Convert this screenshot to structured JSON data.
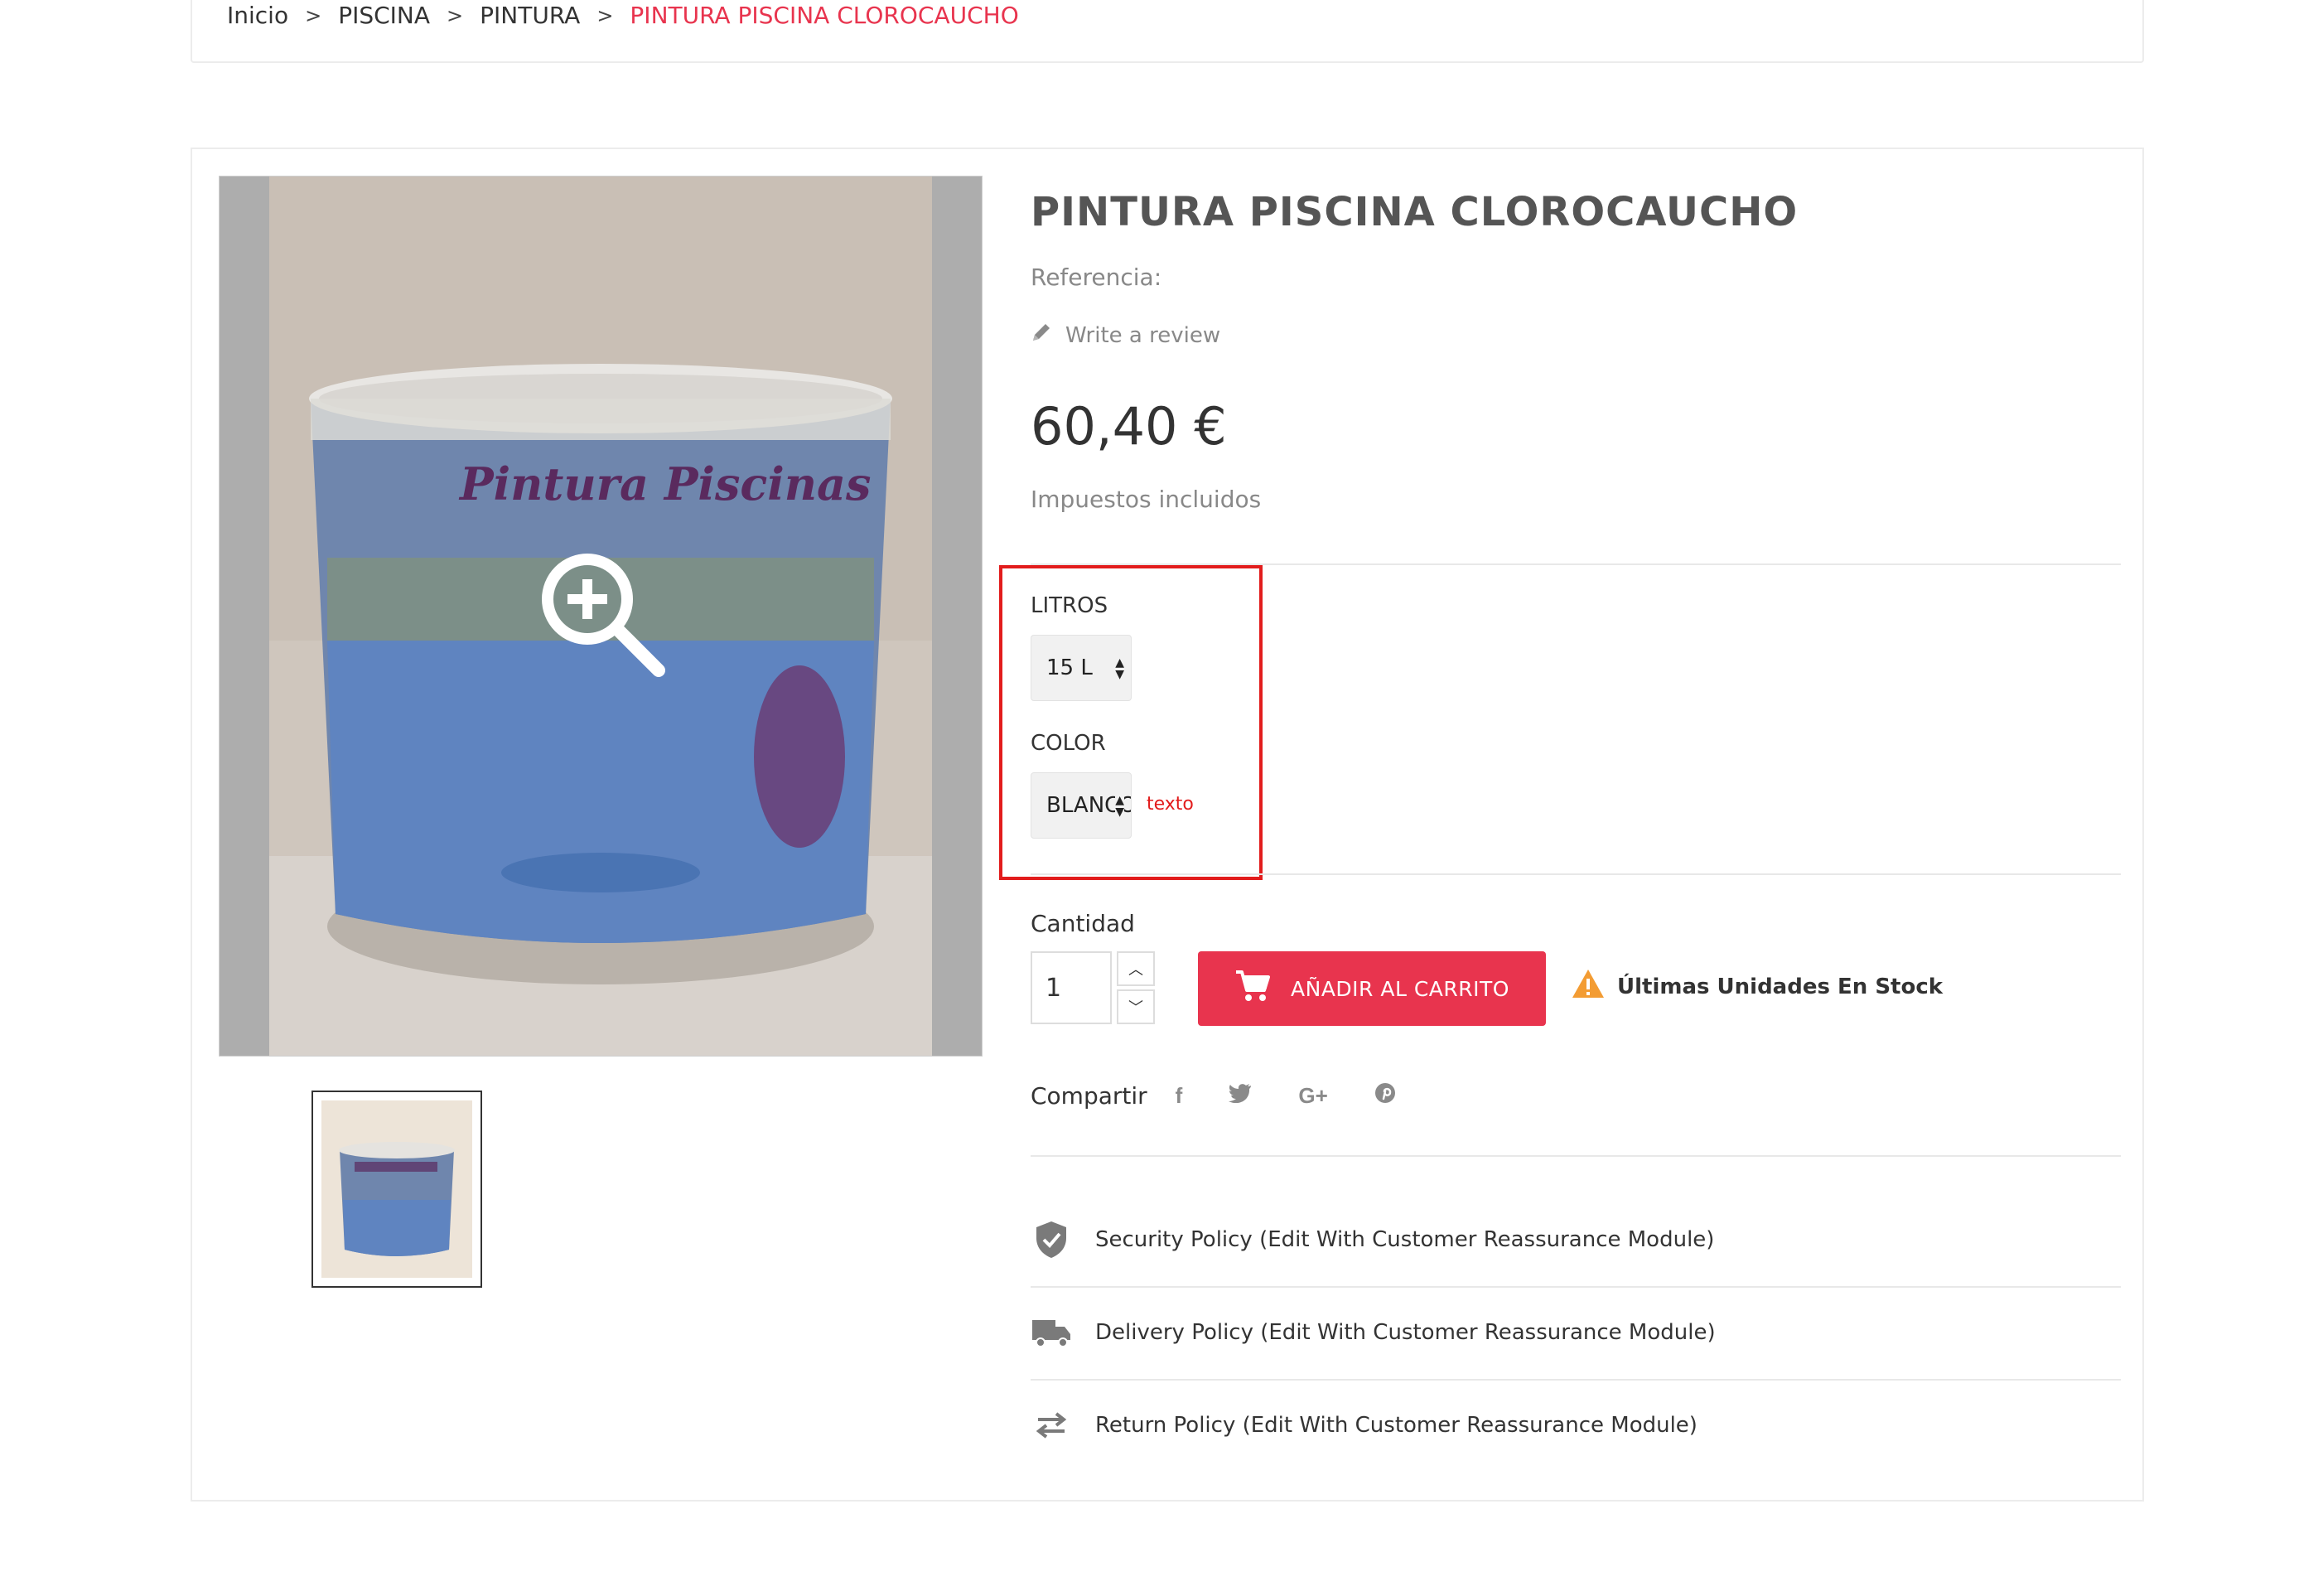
{
  "breadcrumb": {
    "items": [
      "Inicio",
      "PISCINA",
      "PINTURA"
    ],
    "current": "PINTURA PISCINA CLOROCAUCHO",
    "separator": ">"
  },
  "product": {
    "title": "PINTURA PISCINA CLOROCAUCHO",
    "reference_label": "Referencia:",
    "review_link": "Write a review",
    "price": "60,40 €",
    "tax_note": "Impuestos incluidos",
    "image_zoom_icon": "zoom-in-icon"
  },
  "variants": {
    "litros": {
      "label": "LITROS",
      "selected": "15 L"
    },
    "color": {
      "label": "COLOR",
      "selected": "BLANCO",
      "note": "texto"
    }
  },
  "cart": {
    "quantity_label": "Cantidad",
    "quantity_value": "1",
    "add_button": "AÑADIR AL CARRITO",
    "stock_message": "Últimas Unidades En Stock"
  },
  "share": {
    "label": "Compartir",
    "networks": [
      {
        "name": "facebook",
        "glyph": "f"
      },
      {
        "name": "twitter",
        "glyph": "🐦"
      },
      {
        "name": "google-plus",
        "glyph": "G+"
      },
      {
        "name": "pinterest",
        "glyph": "℗"
      }
    ]
  },
  "reassurance": [
    {
      "icon": "shield-icon",
      "text": "Security Policy (Edit With Customer Reassurance Module)"
    },
    {
      "icon": "truck-icon",
      "text": "Delivery Policy (Edit With Customer Reassurance Module)"
    },
    {
      "icon": "arrows-exchange-icon",
      "text": "Return Policy (Edit With Customer Reassurance Module)"
    }
  ],
  "colors": {
    "accent": "#e8344e",
    "highlight_box": "#e21c1c",
    "muted_text": "#888888",
    "warning": "#f39c33"
  }
}
